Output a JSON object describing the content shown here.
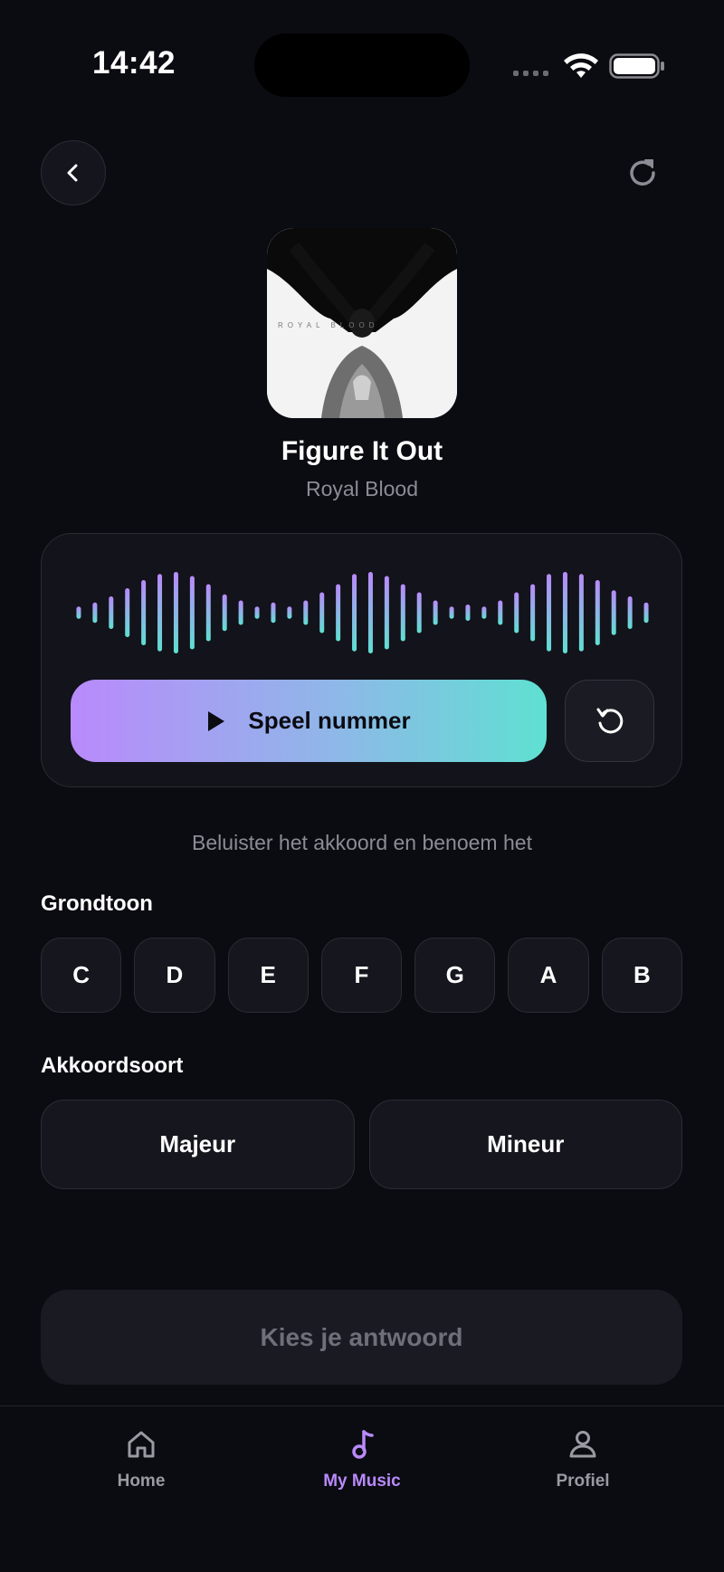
{
  "status_bar": {
    "time": "14:42"
  },
  "track": {
    "title": "Figure It Out",
    "artist": "Royal Blood",
    "album_art_text": "ROYAL BLOOD"
  },
  "player": {
    "play_label": "Speel nummer",
    "waveform_levels": [
      0.15,
      0.25,
      0.4,
      0.6,
      0.8,
      0.95,
      1.0,
      0.9,
      0.7,
      0.45,
      0.3,
      0.15,
      0.25,
      0.15,
      0.3,
      0.5,
      0.7,
      0.95,
      1.0,
      0.9,
      0.7,
      0.5,
      0.3,
      0.15,
      0.2,
      0.15,
      0.3,
      0.5,
      0.7,
      0.95,
      1.0,
      0.95,
      0.8,
      0.55,
      0.4,
      0.25
    ]
  },
  "instruction": "Beluister het akkoord en benoem het",
  "root_note": {
    "label": "Grondtoon",
    "options": [
      "C",
      "D",
      "E",
      "F",
      "G",
      "A",
      "B"
    ]
  },
  "chord_type": {
    "label": "Akkoordsoort",
    "options": [
      "Majeur",
      "Mineur"
    ]
  },
  "submit_label": "Kies je antwoord",
  "tabbar": {
    "items": [
      {
        "label": "Home",
        "icon": "home-icon",
        "active": false
      },
      {
        "label": "My Music",
        "icon": "music-note-icon",
        "active": true
      },
      {
        "label": "Profiel",
        "icon": "person-icon",
        "active": false
      }
    ]
  },
  "colors": {
    "accent": "#b98afb",
    "gradient_end": "#5fe0d2",
    "background": "#0b0b12"
  }
}
